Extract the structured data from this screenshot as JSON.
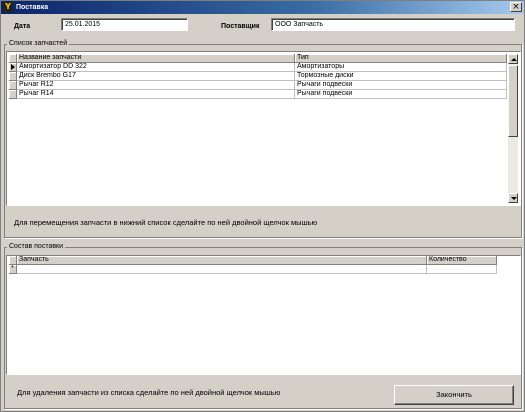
{
  "window": {
    "title": "Поставка",
    "close_glyph": "×"
  },
  "header": {
    "date_label": "Дата",
    "date_value": "25.01.2015",
    "supplier_label": "Поставщик",
    "supplier_value": "ООО Запчасть"
  },
  "parts_list": {
    "group_title": "Список запчастей",
    "columns": [
      "Название запчасти",
      "Тип"
    ],
    "rows": [
      {
        "name": "Амортизатор DD 322",
        "type": "Амортизаторы",
        "selected": true
      },
      {
        "name": "Диск Brembo G17",
        "type": "Тормозные диски",
        "selected": false
      },
      {
        "name": "Рычаг R12",
        "type": "Рычаги подвески",
        "selected": false
      },
      {
        "name": "Рычаг R14",
        "type": "Рычаги подвески",
        "selected": false
      }
    ],
    "hint": "Для перемещения запчасти в нижний список сделайте по ней двойной щелчок мышью"
  },
  "delivery": {
    "group_title": "Состав поставки",
    "columns": [
      "Запчасть",
      "Количество"
    ],
    "new_row_marker": "*",
    "hint": "Для удаления запчасти из списка сделайте по ней двойной щелчок мышью",
    "finish_label": "Закончить"
  }
}
